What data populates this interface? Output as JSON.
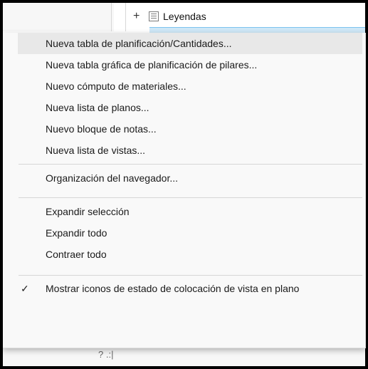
{
  "tree": {
    "expand_glyph": "+",
    "legend_label": "Leyendas",
    "icon": "legend-icon"
  },
  "bottom_glyph": "? .:|",
  "menu": {
    "section1": [
      {
        "label": "Nueva tabla de planificación/Cantidades..."
      },
      {
        "label": "Nueva tabla gráfica de planificación de pilares..."
      },
      {
        "label": "Nuevo cómputo de materiales..."
      },
      {
        "label": "Nueva lista de planos..."
      },
      {
        "label": "Nuevo bloque de notas..."
      },
      {
        "label": "Nueva lista de vistas..."
      }
    ],
    "section2": [
      {
        "label": "Organización del navegador..."
      }
    ],
    "section3": [
      {
        "label": "Expandir selección"
      },
      {
        "label": "Expandir todo"
      },
      {
        "label": "Contraer todo"
      }
    ],
    "section4": [
      {
        "label": "Mostrar iconos de estado de colocación de vista en plano",
        "checked": true,
        "check_glyph": "✓"
      }
    ]
  }
}
